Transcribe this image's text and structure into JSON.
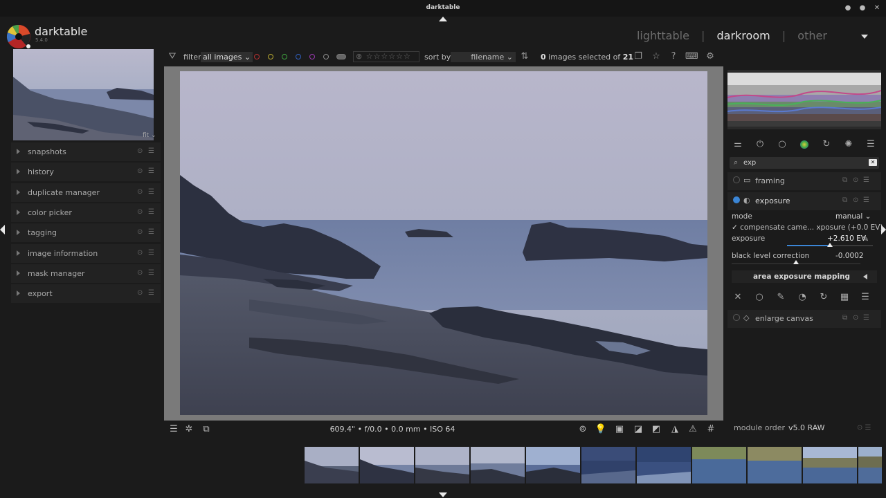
{
  "window": {
    "title": "darktable"
  },
  "app": {
    "name": "darktable",
    "version": "5.4.0"
  },
  "views": {
    "lighttable": "lighttable",
    "darkroom": "darkroom",
    "other": "other",
    "active": "darkroom"
  },
  "toolbar": {
    "filter_label": "filter",
    "filter_value": "all images",
    "sort_label": "sort by",
    "sort_value": "filename",
    "selected_count": "0",
    "selected_text": "images selected of",
    "total": "21",
    "color_labels": [
      "#b43030",
      "#b4a630",
      "#3fa23f",
      "#3060c0",
      "#9a3ab0",
      "#8a8a8a"
    ]
  },
  "navigation": {
    "zoom": "fit"
  },
  "left_modules": [
    {
      "label": "snapshots"
    },
    {
      "label": "history"
    },
    {
      "label": "duplicate manager"
    },
    {
      "label": "color picker"
    },
    {
      "label": "tagging"
    },
    {
      "label": "image information"
    },
    {
      "label": "mask manager"
    },
    {
      "label": "export"
    }
  ],
  "bottom": {
    "exif": "609.4\" • f/0.0 • 0.0 mm • ISO 64"
  },
  "right": {
    "search": "exp",
    "framing": {
      "label": "framing"
    },
    "exposure": {
      "label": "exposure",
      "mode_label": "mode",
      "mode_value": "manual",
      "compensate_label": "compensate came... xposure (+0.0 EV)",
      "exposure_label": "exposure",
      "exposure_value": "+2.610 EV",
      "black_label": "black level correction",
      "black_value": "-0.0002",
      "exposure_fraction": 0.5,
      "black_fraction": 0.5
    },
    "area_mapping": "area exposure mapping",
    "enlarge_canvas": {
      "label": "enlarge canvas"
    },
    "module_order_label": "module order",
    "module_order_value": "v5.0 RAW"
  },
  "colors": {
    "accent": "#3b86d6",
    "background": "#1b1b1b",
    "panel": "#232323"
  }
}
